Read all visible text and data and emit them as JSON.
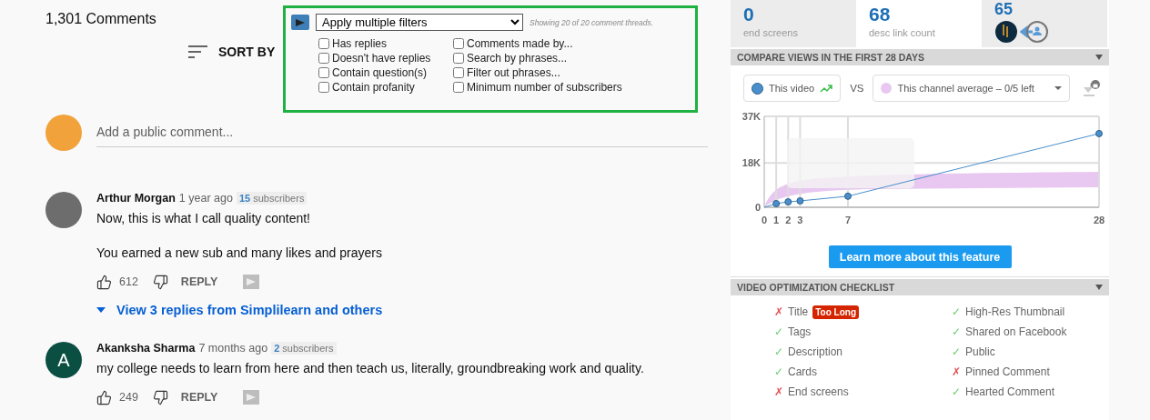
{
  "comments_header": {
    "count": "1,301 Comments",
    "sort_label": "SORT BY"
  },
  "filter_panel": {
    "mode": "Apply multiple filters",
    "status": "Showing 20 of 20 comment threads.",
    "filters": [
      {
        "label": "Has replies",
        "checked": false
      },
      {
        "label": "Comments made by...",
        "checked": false
      },
      {
        "label": "Doesn't have replies",
        "checked": false
      },
      {
        "label": "Search by phrases...",
        "checked": false
      },
      {
        "label": "Contain question(s)",
        "checked": false
      },
      {
        "label": "Filter out phrases...",
        "checked": false
      },
      {
        "label": "Contain profanity",
        "checked": false
      },
      {
        "label": "Minimum number of subscribers",
        "checked": false
      }
    ]
  },
  "add_comment": {
    "placeholder": "Add a public comment..."
  },
  "comments": [
    {
      "author": "Arthur Morgan",
      "time": "1 year ago",
      "subscriber_count": "15",
      "subscriber_label": "subscribers",
      "avatar": {
        "kind": "photo"
      },
      "paragraphs": [
        "Now, this is what I call quality content!",
        "You earned a new sub and many likes and prayers"
      ],
      "likes": "612",
      "reply": "REPLY",
      "replies_link": "View 3 replies from Simplilearn and others"
    },
    {
      "author": "Akanksha Sharma",
      "time": "7 months ago",
      "subscriber_count": "2",
      "subscriber_label": "subscribers",
      "avatar": {
        "kind": "letter",
        "letter": "A"
      },
      "paragraphs": [
        "my college needs to learn from here and then teach us, literally, groundbreaking work and quality."
      ],
      "likes": "249",
      "reply": "REPLY"
    }
  ],
  "stats": [
    {
      "value": "0",
      "label": "end screens",
      "highlighted": false
    },
    {
      "value": "68",
      "label": "desc link count",
      "highlighted": true
    },
    {
      "value": "65",
      "highlighted": false
    }
  ],
  "compare": {
    "title": "COMPARE VIEWS IN THE FIRST 28 DAYS",
    "vs": "VS",
    "average": "This channel average  –  0/5 left",
    "learn_button": "Learn more about this feature",
    "chart_data": {
      "type": "line",
      "x": [
        0,
        1,
        2,
        3,
        7,
        28
      ],
      "series": [
        {
          "name": "This video",
          "color": "#4a8fcb",
          "values": [
            0,
            1500,
            2200,
            2600,
            4500,
            30000
          ],
          "marker": "circle"
        }
      ],
      "xticks": [
        0,
        1,
        2,
        3,
        7,
        28
      ],
      "xlim": [
        0,
        28
      ],
      "grid": true,
      "ylim": [
        0,
        37000
      ],
      "yticks": [
        {
          "value": 0,
          "label": "0"
        },
        {
          "value": 18000,
          "label": "18K"
        },
        {
          "value": 37000,
          "label": "37K"
        }
      ]
    }
  },
  "checklist": {
    "title": "VIDEO OPTIMIZATION CHECKLIST",
    "items": [
      {
        "mark": "✗",
        "label": "Title",
        "passed": false,
        "badge": "Too Long"
      },
      {
        "mark": "✓",
        "label": "High-Res Thumbnail",
        "passed": true
      },
      {
        "mark": "✓",
        "label": "Tags",
        "passed": true
      },
      {
        "mark": "✓",
        "label": "Shared on Facebook",
        "passed": true
      },
      {
        "mark": "✓",
        "label": "Description",
        "passed": true
      },
      {
        "mark": "✓",
        "label": "Public",
        "passed": true
      },
      {
        "mark": "✓",
        "label": "Cards",
        "passed": true
      },
      {
        "mark": "✗",
        "label": "Pinned Comment",
        "passed": false
      },
      {
        "mark": "✗",
        "label": "End screens",
        "passed": false
      },
      {
        "mark": "✓",
        "label": "Hearted Comment",
        "passed": true
      }
    ]
  }
}
